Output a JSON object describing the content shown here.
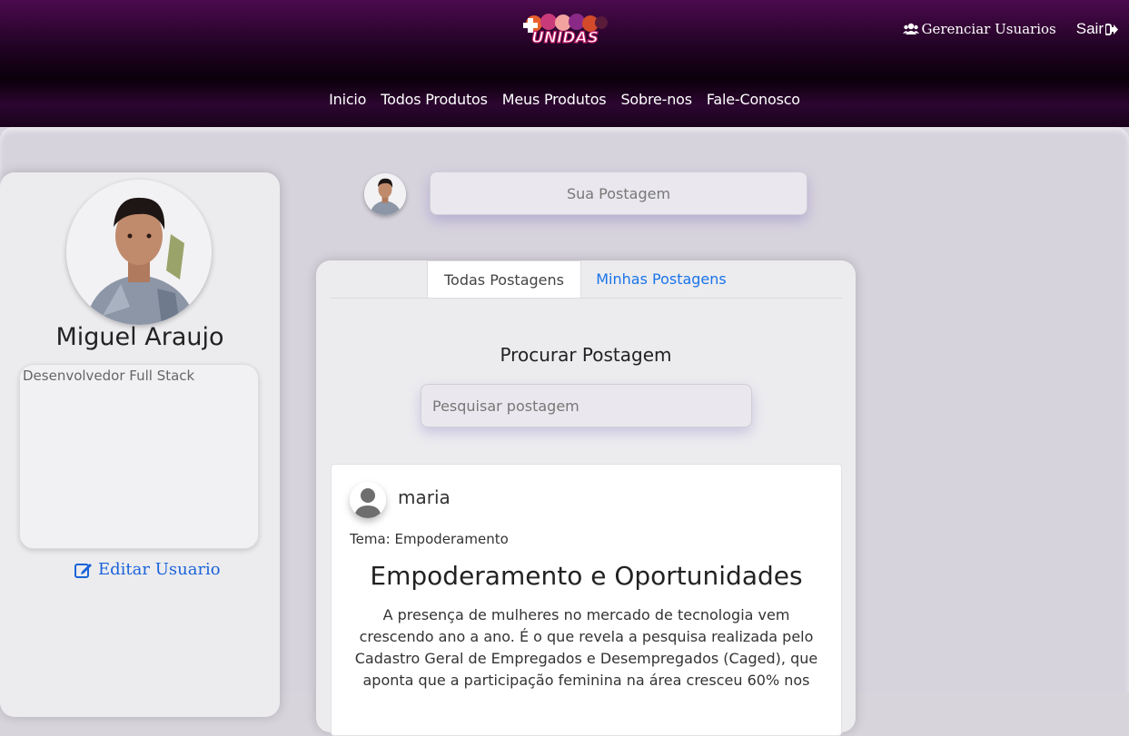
{
  "header": {
    "logo_text": "UNIDAS",
    "manage_users_label": "Gerenciar Usuarios",
    "logout_label": "Sair",
    "nav": [
      "Inicio",
      "Todos Produtos",
      "Meus Produtos",
      "Sobre-nos",
      "Fale-Conosco"
    ]
  },
  "profile": {
    "name": "Miguel Araujo",
    "bio": "Desenvolvedor Full Stack",
    "edit_label": "Editar Usuario"
  },
  "new_post": {
    "placeholder": "Sua Postagem"
  },
  "tabs": {
    "all": "Todas Postagens",
    "mine": "Minhas Postagens"
  },
  "search": {
    "title": "Procurar Postagem",
    "placeholder": "Pesquisar postagem"
  },
  "post": {
    "author": "maria",
    "theme": "Tema: Empoderamento",
    "title": "Empoderamento e Oportunidades",
    "body": "A presença de mulheres no mercado de tecnologia vem crescendo ano a ano. É o que revela a pesquisa realizada pelo Cadastro Geral de Empregados e Desempregados (Caged), que aponta que a participação feminina na área cresceu 60% nos"
  },
  "icons": {
    "manage_users": "users-icon",
    "logout": "sign-out-icon",
    "edit": "edit-icon",
    "default_avatar": "user-silhouette-icon"
  },
  "colors": {
    "header_top": "#4b0a4e",
    "header_dark": "#0b000c",
    "link_blue": "#1a73e8",
    "background": "#d7d3dd"
  }
}
